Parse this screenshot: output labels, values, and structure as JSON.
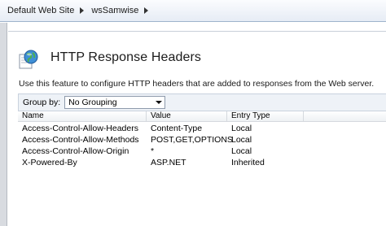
{
  "breadcrumb": {
    "items": [
      {
        "label": "Default Web Site"
      },
      {
        "label": "wsSamwise"
      }
    ]
  },
  "header": {
    "icon": "globe-icon",
    "title": "HTTP Response Headers",
    "description": "Use this feature to configure HTTP headers that are added to responses from the Web server."
  },
  "group_by": {
    "label": "Group by:",
    "value": "No Grouping"
  },
  "table": {
    "columns": [
      "Name",
      "Value",
      "Entry Type"
    ],
    "rows": [
      {
        "name": "Access-Control-Allow-Headers",
        "value": "Content-Type",
        "type": "Local"
      },
      {
        "name": "Access-Control-Allow-Methods",
        "value": "POST,GET,OPTIONS",
        "type": "Local"
      },
      {
        "name": "Access-Control-Allow-Origin",
        "value": "*",
        "type": "Local"
      },
      {
        "name": "X-Powered-By",
        "value": "ASP.NET",
        "type": "Inherited"
      }
    ]
  },
  "colors": {
    "accent": "#2a6db5",
    "header_bar": "#e6ecf5"
  }
}
